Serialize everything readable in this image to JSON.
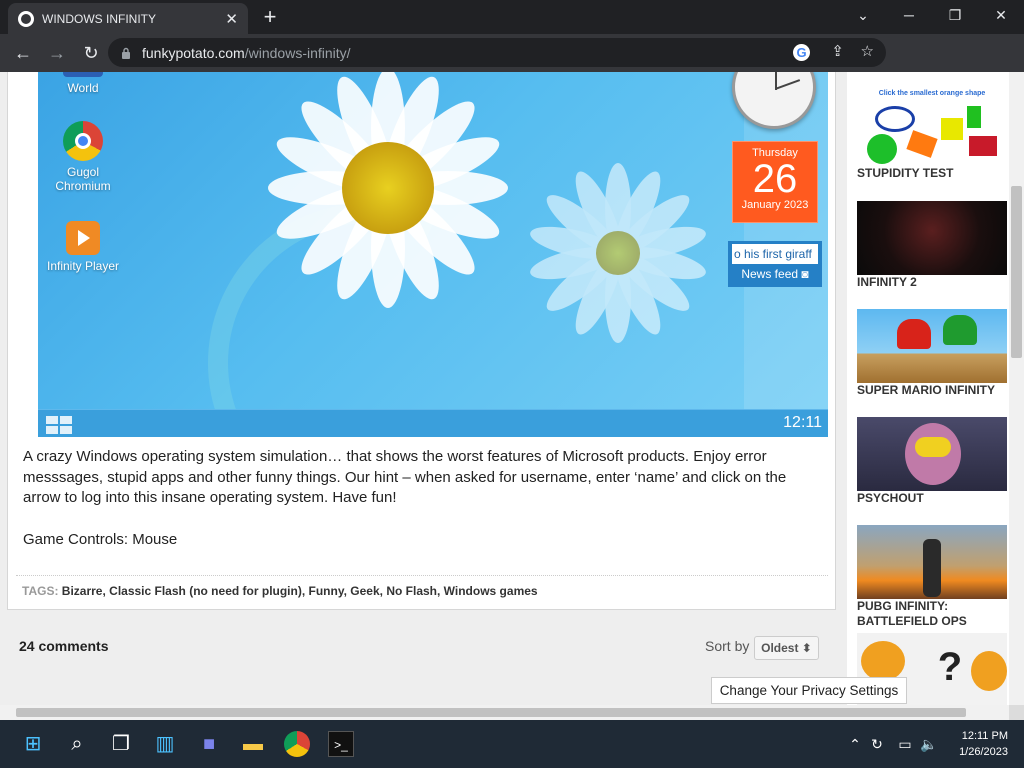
{
  "browser": {
    "tab_title": "WINDOWS INFINITY",
    "url_host": "funkypotato.com",
    "url_path": "/windows-infinity/"
  },
  "game": {
    "desktop_icons": [
      {
        "label": "World",
        "icon": "word-doc-icon"
      },
      {
        "label": "Gugol Chromium",
        "icon": "chromium-icon"
      },
      {
        "label": "Infinity Player",
        "icon": "media-player-icon"
      }
    ],
    "calendar": {
      "weekday": "Thursday",
      "day": "26",
      "month_year": "January 2023"
    },
    "news": {
      "ticker": "o his first giraff",
      "label": "News feed"
    },
    "taskbar_time": "12:11"
  },
  "article": {
    "description": "A crazy Windows operating system simulation… that shows the worst features of Microsoft products. Enjoy error messsages, stupid apps and other funny things. Our hint – when asked for username, enter ‘name’ and click on the arrow to log into this insane operating system. Have fun!",
    "controls": "Game Controls: Mouse",
    "tags_label": "TAGS:",
    "tags": [
      "Bizarre",
      "Classic Flash (no need for plugin)",
      "Funny",
      "Geek",
      "No Flash",
      "Windows games"
    ]
  },
  "comments": {
    "count_label": "24 comments",
    "sort_label": "Sort by",
    "sort_value": "Oldest"
  },
  "privacy_button": "Change Your Privacy Settings",
  "related": [
    {
      "title": "STUPIDITY TEST",
      "caption": "Click the smallest orange shape"
    },
    {
      "title": "INFINITY 2"
    },
    {
      "title": "SUPER MARIO INFINITY"
    },
    {
      "title": "PSYCHOUT"
    },
    {
      "title": "PUBG INFINITY: BATTLEFIELD OPS"
    },
    {
      "title": ""
    }
  ],
  "system": {
    "time": "12:11 PM",
    "date": "1/26/2023"
  },
  "colors": {
    "game_sky": "#3aa3e4",
    "calendar": "#ff5a1f",
    "news": "#2580c6",
    "taskbar": "#1f2a36"
  }
}
